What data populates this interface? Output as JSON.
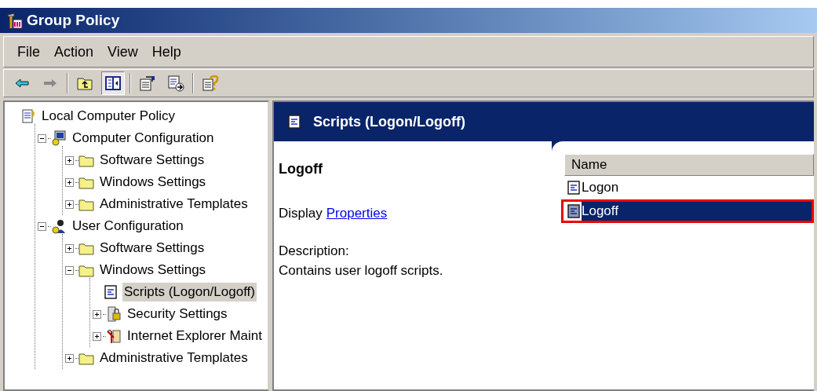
{
  "window": {
    "title": "Group Policy"
  },
  "menu": [
    "File",
    "Action",
    "View",
    "Help"
  ],
  "toolbar": [
    {
      "kind": "back",
      "pressed": false
    },
    {
      "kind": "forward",
      "pressed": false
    },
    {
      "kind": "sep"
    },
    {
      "kind": "up",
      "pressed": false
    },
    {
      "kind": "tree",
      "pressed": true
    },
    {
      "kind": "sep"
    },
    {
      "kind": "properties",
      "pressed": false
    },
    {
      "kind": "export",
      "pressed": false
    },
    {
      "kind": "sep"
    },
    {
      "kind": "help",
      "pressed": false
    }
  ],
  "tree": [
    {
      "label": "Local Computer Policy",
      "kind": "policy",
      "selected": false,
      "children": [
        {
          "label": "Computer Configuration",
          "kind": "computer",
          "expanded": true,
          "selected": false,
          "children": [
            {
              "label": "Software Settings",
              "kind": "folder",
              "expanded": false,
              "selected": false
            },
            {
              "label": "Windows Settings",
              "kind": "folder",
              "expanded": false,
              "selected": false
            },
            {
              "label": "Administrative Templates",
              "kind": "folder",
              "expanded": false,
              "selected": false
            }
          ]
        },
        {
          "label": "User Configuration",
          "kind": "user",
          "expanded": true,
          "selected": false,
          "children": [
            {
              "label": "Software Settings",
              "kind": "folder",
              "expanded": false,
              "selected": false
            },
            {
              "label": "Windows Settings",
              "kind": "folder",
              "expanded": true,
              "selected": false,
              "children": [
                {
                  "label": "Scripts (Logon/Logoff)",
                  "kind": "script",
                  "selected": true
                },
                {
                  "label": "Security Settings",
                  "kind": "security",
                  "expanded": false,
                  "selected": false
                },
                {
                  "label": "Internet Explorer Maint",
                  "kind": "ie",
                  "expanded": false,
                  "selected": false
                }
              ]
            },
            {
              "label": "Administrative Templates",
              "kind": "folder",
              "expanded": false,
              "selected": false
            }
          ]
        }
      ]
    }
  ],
  "details": {
    "header": "Scripts (Logon/Logoff)",
    "item_title": "Logoff",
    "display_prefix": "Display",
    "display_link": "Properties",
    "description_label": "Description:",
    "description": "Contains user logoff scripts."
  },
  "list": {
    "columns": [
      "Name"
    ],
    "rows": [
      {
        "name": "Logon",
        "kind": "script",
        "selected": false,
        "highlighted": false
      },
      {
        "name": "Logoff",
        "kind": "script-disabled",
        "selected": true,
        "highlighted": true
      }
    ]
  }
}
